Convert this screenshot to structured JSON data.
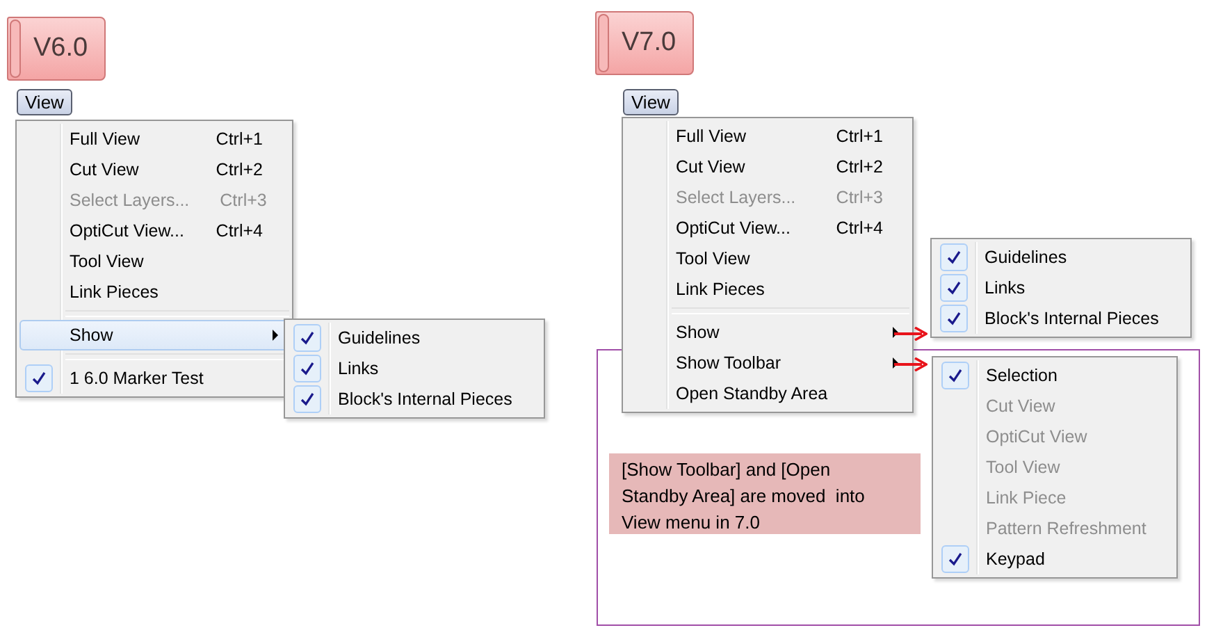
{
  "panels": [
    {
      "version": "V6.0",
      "menu_button": {
        "label": "View",
        "selected": true
      },
      "menu": {
        "items": [
          {
            "kind": "command",
            "label": "Full View",
            "shortcut": "Ctrl+1",
            "disabled": false
          },
          {
            "kind": "command",
            "label": "Cut View",
            "shortcut": "Ctrl+2",
            "disabled": false
          },
          {
            "kind": "command",
            "label": "Select Layers...",
            "shortcut": "Ctrl+3",
            "disabled": true
          },
          {
            "kind": "command",
            "label": "OptiCut View...",
            "shortcut": "Ctrl+4",
            "disabled": false
          },
          {
            "kind": "command",
            "label": "Tool View",
            "disabled": false
          },
          {
            "kind": "command",
            "label": "Link Pieces",
            "disabled": false
          },
          {
            "kind": "separator"
          },
          {
            "kind": "submenu",
            "label": "Show",
            "selected": true
          },
          {
            "kind": "separator"
          },
          {
            "kind": "check",
            "label": "1 6.0 Marker Test",
            "checked": true
          }
        ]
      },
      "submenus": [
        {
          "pointer_arrow": false,
          "items": [
            {
              "label": "Guidelines",
              "checked": true,
              "disabled": false
            },
            {
              "label": "Links",
              "checked": true,
              "disabled": false
            },
            {
              "label": "Block's Internal Pieces",
              "checked": true,
              "disabled": false
            }
          ]
        }
      ]
    },
    {
      "version": "V7.0",
      "menu_button": {
        "label": "View",
        "selected": true
      },
      "menu": {
        "items": [
          {
            "kind": "command",
            "label": "Full View",
            "shortcut": "Ctrl+1",
            "disabled": false
          },
          {
            "kind": "command",
            "label": "Cut View",
            "shortcut": "Ctrl+2",
            "disabled": false
          },
          {
            "kind": "command",
            "label": "Select Layers...",
            "shortcut": "Ctrl+3",
            "disabled": true
          },
          {
            "kind": "command",
            "label": "OptiCut View...",
            "shortcut": "Ctrl+4",
            "disabled": false
          },
          {
            "kind": "command",
            "label": "Tool View",
            "disabled": false
          },
          {
            "kind": "command",
            "label": "Link Pieces",
            "disabled": false
          },
          {
            "kind": "separator"
          },
          {
            "kind": "submenu",
            "label": "Show",
            "selected": false
          },
          {
            "kind": "submenu",
            "label": "Show Toolbar",
            "selected": false
          },
          {
            "kind": "command",
            "label": "Open Standby Area",
            "disabled": false
          }
        ]
      },
      "submenus": [
        {
          "pointer_arrow": true,
          "items": [
            {
              "label": "Guidelines",
              "checked": true,
              "disabled": false
            },
            {
              "label": "Links",
              "checked": true,
              "disabled": false
            },
            {
              "label": "Block's Internal Pieces",
              "checked": true,
              "disabled": false
            }
          ]
        },
        {
          "pointer_arrow": true,
          "items": [
            {
              "label": "Selection",
              "checked": true,
              "disabled": false
            },
            {
              "label": "Cut View",
              "checked": false,
              "disabled": true
            },
            {
              "label": "OptiCut View",
              "checked": false,
              "disabled": true
            },
            {
              "label": "Tool View",
              "checked": false,
              "disabled": true
            },
            {
              "label": "Link Piece",
              "checked": false,
              "disabled": true
            },
            {
              "label": "Pattern Refreshment",
              "checked": false,
              "disabled": true
            },
            {
              "label": "Keypad",
              "checked": true,
              "disabled": false
            }
          ]
        }
      ],
      "note": "[Show Toolbar] and [Open\nStandby Area] are moved  into\nView menu in 7.0"
    }
  ]
}
